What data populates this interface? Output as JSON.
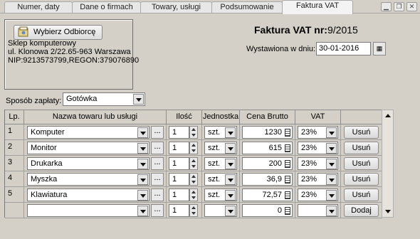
{
  "tabs": [
    "Numer, daty",
    "Dane o firmach",
    "Towary, usługi",
    "Podsumowanie",
    "Faktura VAT"
  ],
  "active_tab": "Faktura VAT",
  "window_controls": [
    "minimize-icon",
    "restore-icon",
    "close-icon"
  ],
  "buyer": {
    "button_label": "Wybierz Odbiorcę",
    "lines": [
      "Sklep komputerowy",
      "ul. Klonowa 2/22.65-963 Warszawa",
      "NIP:9213573799,REGON:379076890"
    ]
  },
  "invoice": {
    "title": "Faktura VAT nr:",
    "number": "9/2015",
    "issue_label": "Wystawiona w dniu:",
    "issue_date": "30-01-2016"
  },
  "payment": {
    "label": "Sposób zapłaty:",
    "value": "Gotówka"
  },
  "table": {
    "headers": [
      "Lp.",
      "Nazwa towaru lub usługi",
      "Ilość",
      "Jednostka",
      "Cena Brutto",
      "VAT"
    ],
    "rows": [
      {
        "lp": "1",
        "name": "Komputer",
        "qty": "1",
        "unit": "szt.",
        "price": "1230",
        "vat": "23%",
        "action": "Usuń"
      },
      {
        "lp": "2",
        "name": "Monitor",
        "qty": "1",
        "unit": "szt.",
        "price": "615",
        "vat": "23%",
        "action": "Usuń"
      },
      {
        "lp": "3",
        "name": "Drukarka",
        "qty": "1",
        "unit": "szt.",
        "price": "200",
        "vat": "23%",
        "action": "Usuń"
      },
      {
        "lp": "4",
        "name": "Myszka",
        "qty": "1",
        "unit": "szt.",
        "price": "36,9",
        "vat": "23%",
        "action": "Usuń"
      },
      {
        "lp": "5",
        "name": "Klawiatura",
        "qty": "1",
        "unit": "szt.",
        "price": "72,57",
        "vat": "23%",
        "action": "Usuń"
      },
      {
        "lp": "",
        "name": "",
        "qty": "1",
        "unit": "",
        "price": "0",
        "vat": "",
        "action": "Dodaj"
      }
    ]
  }
}
